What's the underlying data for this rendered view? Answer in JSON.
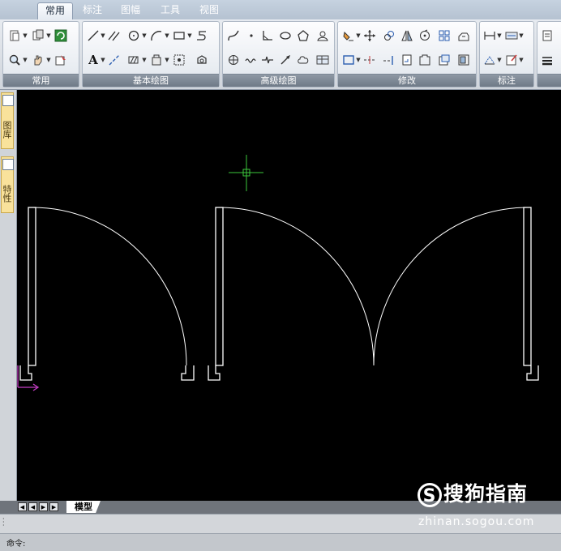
{
  "menu": {
    "tabs": [
      {
        "label": "常用",
        "active": true
      },
      {
        "label": "标注",
        "active": false
      },
      {
        "label": "图幅",
        "active": false
      },
      {
        "label": "工具",
        "active": false
      },
      {
        "label": "视图",
        "active": false
      }
    ]
  },
  "ribbon": {
    "groups": [
      {
        "label": "常用"
      },
      {
        "label": "基本绘图"
      },
      {
        "label": "高级绘图"
      },
      {
        "label": "修改"
      },
      {
        "label": "标注"
      }
    ],
    "text_tool_label": "A"
  },
  "side_panel": {
    "tabs": [
      {
        "label": "图库",
        "icon": "library-icon"
      },
      {
        "label": "特性",
        "icon": "properties-icon"
      }
    ]
  },
  "layout_tabs": {
    "nav_buttons": [
      "first-layout",
      "previous-layout",
      "next-layout",
      "last-layout"
    ],
    "active_tab": "模型"
  },
  "command": {
    "prompt_label": "命令:"
  },
  "watermark": {
    "logo_text": "搜狗指南",
    "url": "zhinan.sogou.com"
  },
  "colors": {
    "canvas": "#000000",
    "drawing_lines": "#ffffff",
    "crosshair": "#3cc83c",
    "ucs_icon": "#c23cc2",
    "group_label_bg": "#7b8694",
    "side_tab_bg": "#f9e29b"
  }
}
